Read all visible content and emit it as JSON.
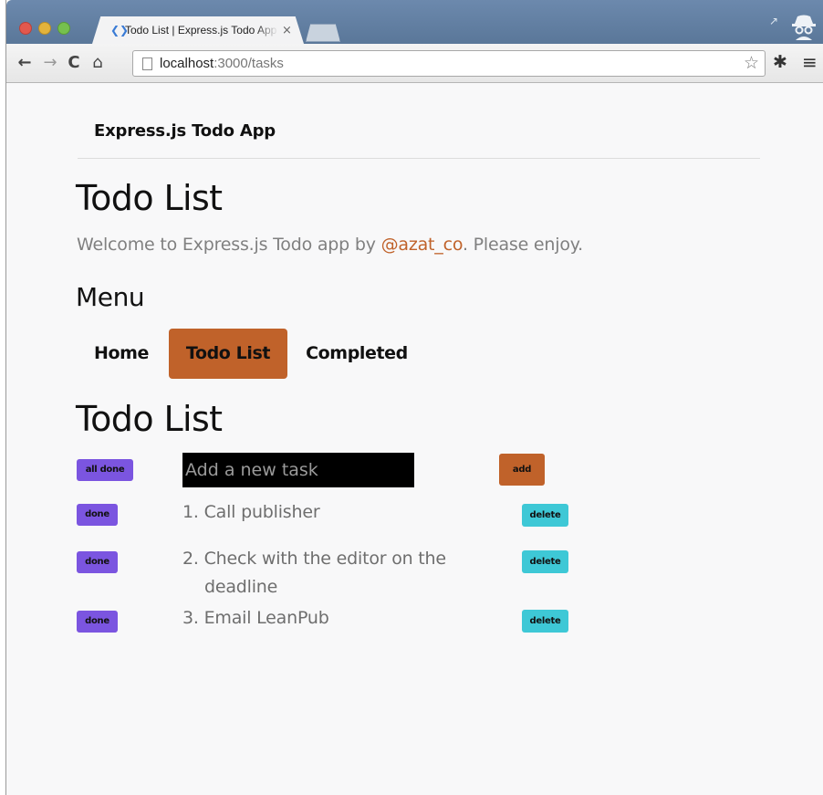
{
  "browser": {
    "tab_title": "Todo List | Express.js Todo App",
    "url_host": "localhost",
    "url_rest": ":3000/tasks",
    "close_glyph": "×"
  },
  "navbar": {
    "brand": "Express.js Todo App"
  },
  "page": {
    "title": "Todo List",
    "lead_prefix": "Welcome to Express.js Todo app by ",
    "lead_link": "@azat_co",
    "lead_suffix": ". Please enjoy."
  },
  "menu": {
    "heading": "Menu",
    "items": [
      "Home",
      "Todo List",
      "Completed"
    ],
    "active": "Todo List"
  },
  "todo": {
    "heading": "Todo List",
    "all_done_label": "all done",
    "input_placeholder": "Add a new task",
    "add_label": "add",
    "tasks": [
      {
        "number": "1.",
        "text": "Call publisher",
        "done_label": "done",
        "delete_label": "delete"
      },
      {
        "number": "2.",
        "text_line1": "Check with the editor on the",
        "text_line2": "deadline",
        "done_label": "done",
        "delete_label": "delete"
      },
      {
        "number": "3.",
        "text": "Email LeanPub",
        "done_label": "done",
        "delete_label": "delete"
      }
    ]
  },
  "colors": {
    "accent": "#c0622a",
    "done_button": "#7b55e0",
    "delete_button": "#3ec8d6"
  }
}
